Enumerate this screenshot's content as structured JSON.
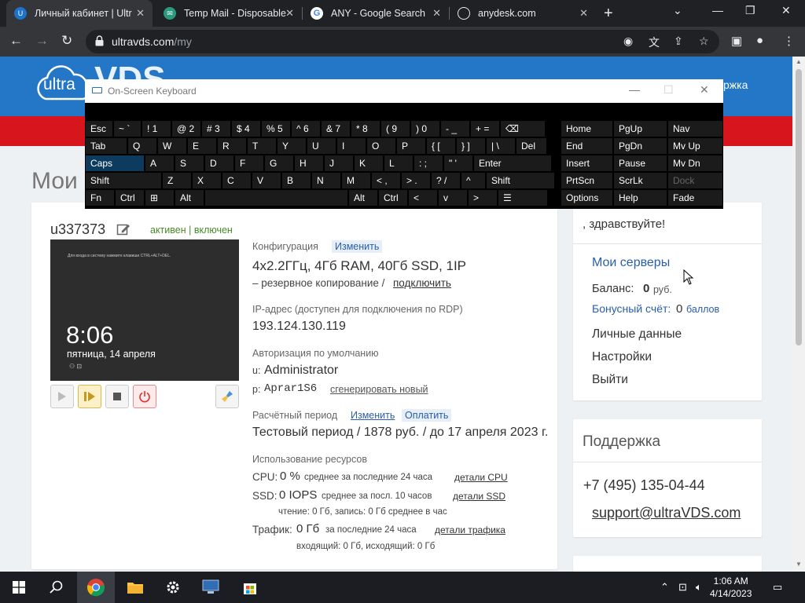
{
  "browser": {
    "tabs": [
      {
        "title": "Личный кабинет | Ultr",
        "favicon": "ultravds-favicon",
        "active": true
      },
      {
        "title": "Temp Mail - Disposable",
        "favicon": "tempmail-favicon",
        "active": false
      },
      {
        "title": "ANY - Google Search",
        "favicon": "google-favicon",
        "active": false
      },
      {
        "title": "anydesk.com",
        "favicon": "globe-favicon",
        "active": false
      }
    ],
    "url_host": "ultravds.com",
    "url_path": "/my"
  },
  "site": {
    "logo_text": "ultra",
    "header_link": "ржка",
    "page_title": "Мои с"
  },
  "server": {
    "name": "u337373",
    "status": "активен | включен",
    "screen_tiny": "Для входа в систему нажмите клавиши CTRL+ALT+DEL.",
    "screen_time": "8:06",
    "screen_date": "пятница, 14 апреля",
    "config_label": "Конфигурация",
    "config_change": "Изменить",
    "config_value": "4x2.2ГГц, 4Гб RAM, 40Гб SSD, 1IP",
    "backup_text": "– резервное копирование /",
    "backup_link": "подключить",
    "ip_label": "IP-адрес (доступен для подключения по RDP)",
    "ip_value": "193.124.130.119",
    "auth_label": "Авторизация по умолчанию",
    "user_prefix": "u:",
    "user_value": "Administrator",
    "pass_prefix": "p:",
    "pass_value": "Aprar1S6",
    "pass_regen": "сгенерировать новый",
    "billing_label": "Расчётный период",
    "billing_change": "Изменить",
    "billing_pay": "Оплатить",
    "billing_value": "Тестовый период / 1878 руб. / до 17 апреля 2023 г.",
    "usage_label": "Использование ресурсов",
    "cpu_label": "CPU:",
    "cpu_value": "0 %",
    "cpu_note": "среднее за последние 24 часа",
    "cpu_link": "детали CPU",
    "ssd_label": "SSD:",
    "ssd_value": "0 IOPS",
    "ssd_note": "среднее за посл. 10 часов",
    "ssd_link": "детали SSD",
    "ssd_sub": "чтение: 0 Гб, запись: 0 Гб   среднее в час",
    "traffic_label": "Трафик:",
    "traffic_value": "0 Гб",
    "traffic_note": "за последние 24 часа",
    "traffic_link": "детали трафика",
    "traffic_sub": "входящий: 0 Гб, исходящий: 0 Гб"
  },
  "sidebar": {
    "greeting": ", здравствуйте!",
    "my_servers": "Мои серверы",
    "balance_label": "Баланс:",
    "balance_value": "0",
    "balance_unit": "руб.",
    "bonus_label": "Бонусный счёт:",
    "bonus_value": "0",
    "bonus_unit": "баллов",
    "personal": "Личные данные",
    "settings": "Настройки",
    "logout": "Выйти",
    "support_title": "Поддержка",
    "phone": "+7 (495) 135-04-44",
    "email": "support@ultraVDS.com"
  },
  "osk": {
    "title": "On-Screen Keyboard",
    "row1": [
      [
        "Esc",
        ""
      ],
      [
        "~ `",
        ""
      ],
      [
        "! 1",
        ""
      ],
      [
        "@ 2",
        ""
      ],
      [
        "# 3",
        ""
      ],
      [
        "$ 4",
        ""
      ],
      [
        "% 5",
        ""
      ],
      [
        "^ 6",
        ""
      ],
      [
        "& 7",
        ""
      ],
      [
        "* 8",
        ""
      ],
      [
        "( 9",
        ""
      ],
      [
        ") 0",
        ""
      ],
      [
        "- _",
        ""
      ],
      [
        "+ =",
        ""
      ],
      [
        "⌫",
        ""
      ]
    ],
    "row2": [
      "Tab",
      "Q",
      "W",
      "E",
      "R",
      "T",
      "Y",
      "U",
      "I",
      "O",
      "P",
      "{ [",
      "} ]",
      "| \\",
      "Del"
    ],
    "row3": [
      "Caps",
      "A",
      "S",
      "D",
      "F",
      "G",
      "H",
      "J",
      "K",
      "L",
      ": ;",
      "\" '",
      "Enter"
    ],
    "row4": [
      "Shift",
      "Z",
      "X",
      "C",
      "V",
      "B",
      "N",
      "M",
      "< ,",
      "> .",
      "? /",
      "^",
      "Shift"
    ],
    "row5": [
      "Fn",
      "Ctrl",
      "⊞",
      "Alt",
      "",
      "Alt",
      "Ctrl",
      "<",
      "v",
      ">",
      "☰"
    ],
    "nav": [
      [
        "Home",
        "PgUp",
        "Nav"
      ],
      [
        "End",
        "PgDn",
        "Mv Up"
      ],
      [
        "Insert",
        "Pause",
        "Mv Dn"
      ],
      [
        "PrtScn",
        "ScrLk",
        "Dock"
      ],
      [
        "Options",
        "Help",
        "Fade"
      ]
    ]
  },
  "taskbar": {
    "time": "1:06 AM",
    "date": "4/14/2023"
  },
  "colors": {
    "brand_blue": "#2377c6",
    "brand_red": "#d7151d",
    "link_blue": "#2a5ea8",
    "status_green": "#4a8a2a"
  }
}
